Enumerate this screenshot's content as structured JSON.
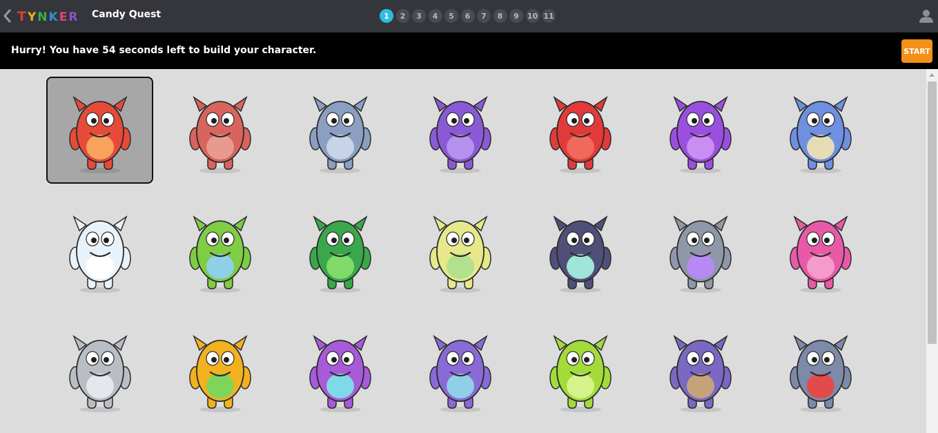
{
  "header": {
    "logo_text": "TYNKER",
    "logo_letters": [
      "T",
      "Y",
      "N",
      "K",
      "E",
      "R"
    ],
    "title": "Candy Quest",
    "pages": [
      "1",
      "2",
      "3",
      "4",
      "5",
      "6",
      "7",
      "8",
      "9",
      "10",
      "11"
    ],
    "active_page": "1",
    "back_icon": "chevron-left-icon",
    "user_icon": "user-icon"
  },
  "banner": {
    "message": "Hurry! You have 54 seconds left to build your character.",
    "start_label": "START"
  },
  "colors": {
    "topbar": "#35363b",
    "banner": "#000000",
    "accent": "#2ebde0",
    "start_button": "#f39018",
    "grid_background": "#dcdcdc",
    "selected_cell": "#a7a7a7"
  },
  "characters": {
    "selected_index": 0,
    "items": [
      {
        "icon": "red-furry-monster-icon",
        "color": "#e84a3a",
        "belly": "#f7a35c"
      },
      {
        "icon": "red-ant-creature-icon",
        "color": "#d9645e",
        "belly": "#e99a8f"
      },
      {
        "icon": "robot-bug-icon",
        "color": "#8a9fc2",
        "belly": "#c7d3e6"
      },
      {
        "icon": "purple-bat-icon",
        "color": "#8a5ad6",
        "belly": "#b691ee"
      },
      {
        "icon": "red-block-monster-icon",
        "color": "#e23a3a",
        "belly": "#ef6a5a"
      },
      {
        "icon": "purple-horned-monster-icon",
        "color": "#9b4fe0",
        "belly": "#c98ef2"
      },
      {
        "icon": "blue-furry-monster-icon",
        "color": "#6f8fe0",
        "belly": "#e6dcb4"
      },
      {
        "icon": "ghost-monster-icon",
        "color": "#e8f2fb",
        "belly": "#ffffff"
      },
      {
        "icon": "green-furry-monster-icon",
        "color": "#7fcc45",
        "belly": "#8fd0e8"
      },
      {
        "icon": "green-drill-robot-icon",
        "color": "#3aa84a",
        "belly": "#7fdc6a"
      },
      {
        "icon": "yellow-horned-monster-icon",
        "color": "#e6e88a",
        "belly": "#b3e08c"
      },
      {
        "icon": "blue-fly-bug-icon",
        "color": "#4f4f78",
        "belly": "#9fe6d8"
      },
      {
        "icon": "robot-fly-icon",
        "color": "#8f97a8",
        "belly": "#b68af2"
      },
      {
        "icon": "pink-monster-icon",
        "color": "#e85aa8",
        "belly": "#f49bcb"
      },
      {
        "icon": "knight-robot-icon",
        "color": "#b9bec6",
        "belly": "#e4e7ec"
      },
      {
        "icon": "yellow-spiky-monster-icon",
        "color": "#f2b21e",
        "belly": "#7fd45a"
      },
      {
        "icon": "purple-blue-hair-monster-icon",
        "color": "#a85ad9",
        "belly": "#7fd9e6"
      },
      {
        "icon": "purple-sad-monster-icon",
        "color": "#8a6ad6",
        "belly": "#8fd0e8"
      },
      {
        "icon": "green-slug-monster-icon",
        "color": "#a3dc3a",
        "belly": "#d6f28a"
      },
      {
        "icon": "purple-owl-monster-icon",
        "color": "#7a68c2",
        "belly": "#c4a27a"
      },
      {
        "icon": "gray-spider-robot-icon",
        "color": "#7d8aa8",
        "belly": "#e44a4a"
      }
    ]
  }
}
